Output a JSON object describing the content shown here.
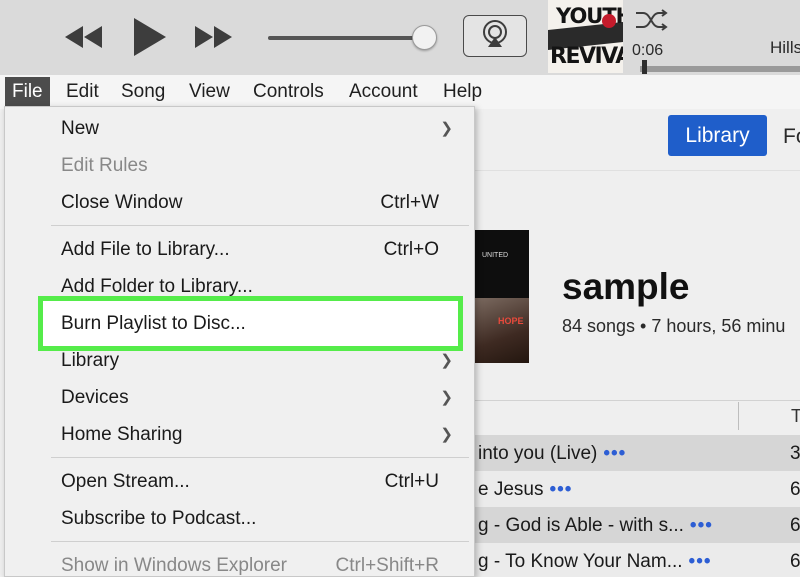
{
  "player": {
    "icons": [
      "rewind-icon",
      "play-icon",
      "fast-forward-icon",
      "airplay-icon",
      "shuffle-icon"
    ],
    "album_art_lines": [
      "YOUTH",
      "REVIVAL"
    ],
    "elapsed": "0:06",
    "track_title": "Hills",
    "volume": 0.92,
    "progress": 0.02
  },
  "menubar": {
    "items": [
      "File",
      "Edit",
      "Song",
      "View",
      "Controls",
      "Account",
      "Help"
    ]
  },
  "file_menu": {
    "items": [
      {
        "label": "New",
        "submenu": true
      },
      {
        "label": "Edit Rules",
        "disabled": true
      },
      {
        "label": "Close Window",
        "shortcut": "Ctrl+W"
      },
      {
        "label": "Add File to Library...",
        "shortcut": "Ctrl+O"
      },
      {
        "label": "Add Folder to Library..."
      },
      {
        "label": "Burn Playlist to Disc...",
        "highlighted": true
      },
      {
        "label": "Library",
        "submenu": true
      },
      {
        "label": "Devices",
        "submenu": true
      },
      {
        "label": "Home Sharing",
        "submenu": true
      },
      {
        "label": "Open Stream...",
        "shortcut": "Ctrl+U"
      },
      {
        "label": "Subscribe to Podcast..."
      },
      {
        "label": "Show in Windows Explorer",
        "shortcut": "Ctrl+Shift+R",
        "disabled": true
      }
    ],
    "highlight_color": "#55ec4a"
  },
  "content": {
    "library_button": "Library",
    "next_tab": "Fo",
    "cover_text": {
      "top": "UNITED",
      "bottom": "HOPE"
    },
    "playlist_name": "sample",
    "playlist_meta": "84 songs • 7 hours, 56 minu",
    "column_time_header": "T",
    "rows": [
      {
        "title": "into you (Live)",
        "time": "3"
      },
      {
        "title": "e Jesus",
        "time": "6"
      },
      {
        "title": "g - God is Able - with s...",
        "time": "6"
      },
      {
        "title": "g - To Know Your Nam...",
        "time": "6"
      }
    ],
    "more_label": "•••",
    "accent_color": "#1f5eca"
  }
}
